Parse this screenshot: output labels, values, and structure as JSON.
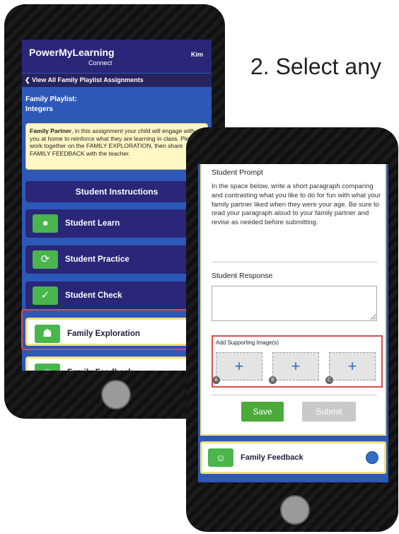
{
  "caption": "2. Select any",
  "phone1": {
    "header": {
      "logo": "PowerMyLearning",
      "logo_sub": "Connect",
      "user": "Kim"
    },
    "nav_back": "❮ View All Family Playlist Assignments",
    "playlist_label": "Family Playlist:",
    "playlist_name": "Integers",
    "partner_bold": "Family Partner",
    "partner_text": ", in this assignment your child will engage with you at home to reinforce what they are learning in class. Please work together on the FAMILY EXPLORATION, then share FAMILY FEEDBACK with the teacher.",
    "instructions_button": "Student Instructions",
    "activities": [
      {
        "label": "Student Learn",
        "icon": "lightbulb-icon"
      },
      {
        "label": "Student Practice",
        "icon": "refresh-icon"
      },
      {
        "label": "Student Check",
        "icon": "checklist-icon"
      },
      {
        "label": "Family Exploration",
        "icon": "family-board-icon"
      },
      {
        "label": "Family Feedback",
        "icon": "family-icon"
      }
    ]
  },
  "phone2": {
    "prompt_heading": "Student Prompt",
    "prompt_text": "In the space below, write a short paragraph comparing and contrasting what you like to do for fun with what your family partner liked when they were your age. Be sure to read your paragraph aloud to your family partner and revise as needed before submitting.",
    "response_heading": "Student Response",
    "images_label": "Add Supporting Image(s)",
    "slots": [
      {
        "symbol": "+",
        "tag": "A"
      },
      {
        "symbol": "+",
        "tag": "B"
      },
      {
        "symbol": "+",
        "tag": "C"
      }
    ],
    "save_label": "Save",
    "submit_label": "Submit",
    "feedback_label": "Family Feedback"
  },
  "colors": {
    "navy": "#2a2678",
    "blue": "#2d58b8",
    "green": "#49b54c",
    "highlight": "#d94d4d"
  }
}
